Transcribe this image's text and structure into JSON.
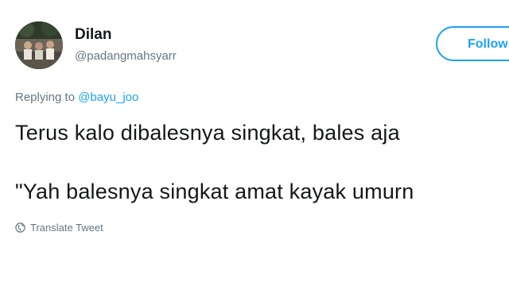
{
  "user": {
    "display_name": "Dilan",
    "username": "@padangmahsyarr",
    "avatar_icon": "profile-photo"
  },
  "follow_button": {
    "label": "Follow",
    "color": "#1da1f2"
  },
  "reply": {
    "prefix": "Replying to",
    "handle": "@bayu_joo"
  },
  "tweet": {
    "line1": "Terus kalo dibalesnya singkat, bales aja",
    "line2": "\"Yah balesnya singkat amat kayak umurn"
  },
  "translate": {
    "icon": "globe-icon",
    "label": "Translate Tweet"
  },
  "colors": {
    "text": "#14171a",
    "secondary": "#657786",
    "accent": "#1da1f2"
  }
}
